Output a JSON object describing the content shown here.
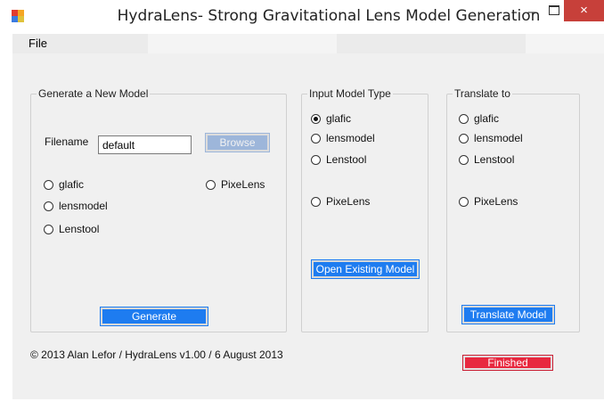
{
  "window": {
    "title": "HydraLens- Strong Gravitational Lens Model Generation",
    "controls": {
      "minimize": "–",
      "close": "×"
    }
  },
  "menu": {
    "file": "File"
  },
  "generate_group": {
    "title": "Generate a New Model",
    "filename_label": "Filename",
    "filename_value": "default",
    "browse_label": "Browse",
    "options": [
      "glafic",
      "lensmodel",
      "Lenstool",
      "PixeLens"
    ],
    "generate_label": "Generate"
  },
  "input_group": {
    "title": "Input Model Type",
    "options": [
      "glafic",
      "lensmodel",
      "Lenstool",
      "PixeLens"
    ],
    "selected": "glafic",
    "open_label": "Open Existing Model"
  },
  "translate_group": {
    "title": "Translate to",
    "options": [
      "glafic",
      "lensmodel",
      "Lenstool",
      "PixeLens"
    ],
    "translate_label": "Translate Model"
  },
  "status": {
    "finished_label": "Finished"
  },
  "footer": {
    "copyright": "© 2013 Alan Lefor / HydraLens v1.00 /  6 August 2013"
  },
  "colors": {
    "accent": "#1e7cf0",
    "status_red": "#e8283f",
    "close_red": "#c7403a"
  },
  "icons": {
    "app": "app-icon"
  }
}
